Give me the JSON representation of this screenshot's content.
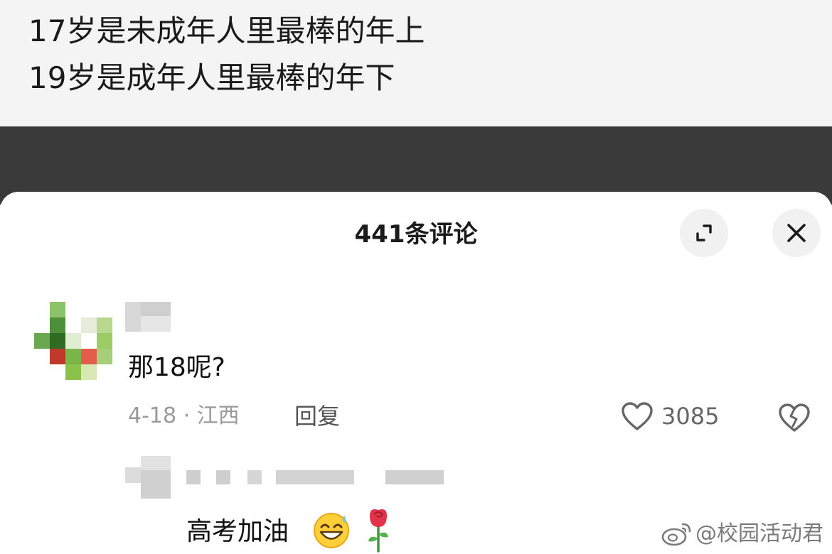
{
  "caption": {
    "line1": "17岁是未成年人里最棒的年上",
    "line2": "19岁是成年人里最棒的年下"
  },
  "comments_sheet": {
    "title": "441条评论",
    "expand_icon": "expand-icon",
    "close_icon": "close-icon"
  },
  "comment": {
    "text": "那18呢?",
    "meta": "4-18 · 江西",
    "reply_label": "回复",
    "like_icon": "heart-outline-icon",
    "likes": "3085",
    "dislike_icon": "broken-heart-icon"
  },
  "reply": {
    "text": "高考加油",
    "emojis": [
      "grinning-sweat-emoji",
      "rose-emoji"
    ]
  },
  "watermark": {
    "text": "@校园活动君",
    "icon": "weibo-logo-icon"
  },
  "colors": {
    "sheet_bg": "#ffffff",
    "video_strip": "#3a3a3a",
    "meta_text": "#9a9a9a"
  }
}
